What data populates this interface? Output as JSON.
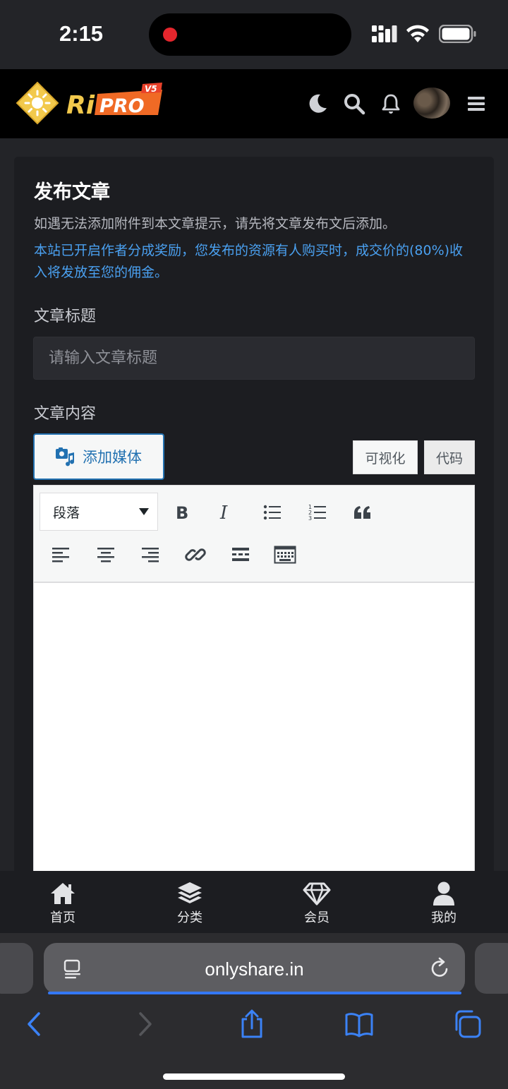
{
  "status_bar": {
    "time": "2:15"
  },
  "header": {
    "logo_text": "Ri PRO",
    "logo_badge": "V5",
    "icons": [
      "moon-icon",
      "search-icon",
      "bell-icon",
      "avatar",
      "menu-icon"
    ]
  },
  "post_form": {
    "title": "发布文章",
    "tip": "如遇无法添加附件到本文章提示，请先将文章发布文后添加。",
    "notice": "本站已开启作者分成奖励，您发布的资源有人购买时，成交价的(80%)收入将发放至您的佣金。",
    "title_label": "文章标题",
    "title_placeholder": "请输入文章标题",
    "title_value": "",
    "content_label": "文章内容",
    "add_media_label": "添加媒体",
    "tab_visual": "可视化",
    "tab_code": "代码"
  },
  "editor_toolbar": {
    "format_selected": "段落",
    "buttons": [
      "bold-icon",
      "italic-icon",
      "bullet-list-icon",
      "numbered-list-icon",
      "blockquote-icon",
      "align-left-icon",
      "align-center-icon",
      "align-right-icon",
      "link-icon",
      "read-more-icon",
      "toolbar-toggle-icon"
    ]
  },
  "bottom_nav": {
    "items": [
      {
        "label": "首页",
        "icon": "home-icon"
      },
      {
        "label": "分类",
        "icon": "layers-icon"
      },
      {
        "label": "会员",
        "icon": "diamond-icon"
      },
      {
        "label": "我的",
        "icon": "user-icon"
      }
    ]
  },
  "browser": {
    "url": "onlyshare.in",
    "icons": [
      "reader-icon",
      "reload-icon",
      "back-icon",
      "forward-icon",
      "share-icon",
      "bookmarks-icon",
      "tabs-icon"
    ]
  },
  "colors": {
    "accent_link": "#4aa0f0",
    "wp_blue": "#2271b1",
    "logo_yellow": "#f2c94c",
    "logo_orange": "#f06a25"
  }
}
